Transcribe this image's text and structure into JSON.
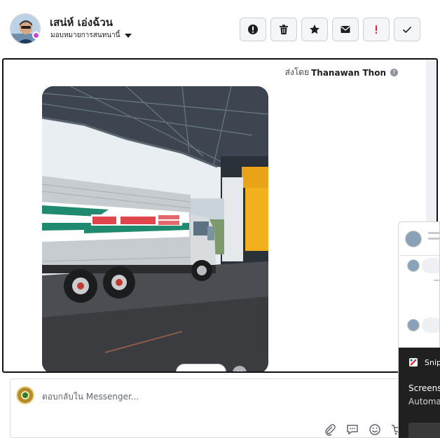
{
  "header": {
    "contact_name": "เสน่ห์ เอ่งฉ้วน",
    "assign_label": "มอบหมายการสนทนานี้",
    "toolbar": [
      {
        "name": "spam-button",
        "icon": "alert-circle-icon"
      },
      {
        "name": "delete-button",
        "icon": "trash-icon"
      },
      {
        "name": "star-button",
        "icon": "star-icon"
      },
      {
        "name": "mark-unread-button",
        "icon": "envelope-icon"
      },
      {
        "name": "follow-up-button",
        "icon": "exclamation-icon"
      },
      {
        "name": "done-button",
        "icon": "check-icon"
      }
    ]
  },
  "message": {
    "sent_by_prefix": "ส่งโดย",
    "sent_by_name": "Thanawan Thon"
  },
  "composer": {
    "placeholder": "ตอบกลับใน Messenger..."
  },
  "snip_toast": {
    "title": "Snip",
    "line1": "Screens",
    "line2": "Automa"
  },
  "colors": {
    "accent_follow_up": "#e41e3f",
    "toast_bg": "#202020",
    "border": "#ccd0d5"
  }
}
